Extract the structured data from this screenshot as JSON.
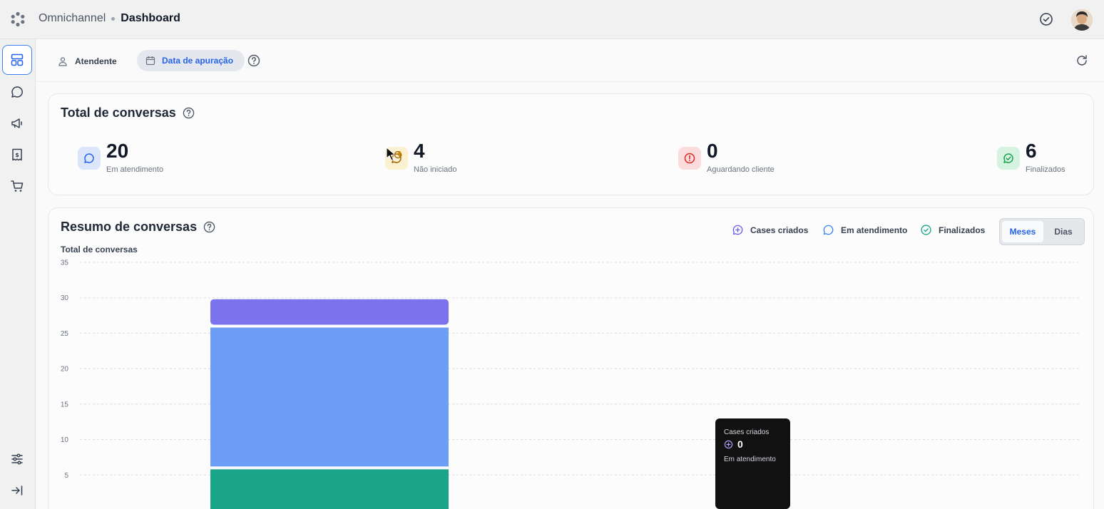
{
  "header": {
    "app_name": "Omnichannel",
    "page_title": "Dashboard"
  },
  "filters": {
    "atendente_label": "Atendente",
    "data_label": "Data de apuração"
  },
  "total_card": {
    "title": "Total de conversas",
    "stats": [
      {
        "value": "20",
        "label": "Em atendimento",
        "color": "#2563eb",
        "bg": "#dbe6fb"
      },
      {
        "value": "4",
        "label": "Não iniciado",
        "color": "#ca8a04",
        "bg": "#fbf0cf"
      },
      {
        "value": "0",
        "label": "Aguardando cliente",
        "color": "#dc2626",
        "bg": "#fbdcdc"
      },
      {
        "value": "6",
        "label": "Finalizados",
        "color": "#16a34a",
        "bg": "#d6f3e2"
      }
    ]
  },
  "resumo_card": {
    "title": "Resumo de conversas",
    "legend": [
      {
        "label": "Cases criados",
        "color": "#6d5cf0"
      },
      {
        "label": "Em atendimento",
        "color": "#3b82f6"
      },
      {
        "label": "Finalizados",
        "color": "#16a38a"
      }
    ],
    "toggle": {
      "meses": "Meses",
      "dias": "Dias"
    },
    "chart_subtitle": "Total de conversas"
  },
  "chart_data": {
    "type": "bar",
    "stacked": true,
    "y_ticks": [
      5,
      10,
      15,
      20,
      25,
      30,
      35
    ],
    "ylim": [
      0,
      35
    ],
    "bars": [
      {
        "segments": [
          {
            "series": "Finalizados",
            "value": 6,
            "color": "#1aa589"
          },
          {
            "series": "Em atendimento",
            "value": 20,
            "color": "#6d9ef5"
          },
          {
            "series": "Cases criados",
            "value": 4,
            "color": "#7b72ee"
          }
        ]
      }
    ]
  },
  "tooltip": {
    "line1_label": "Cases criados",
    "line1_value": "0",
    "line2_label": "Em atendimento"
  },
  "icons": {
    "logo": "logo-icon",
    "check": "check-circle-icon",
    "refresh": "refresh-icon",
    "sidebar": [
      "dashboard-icon",
      "chat-icon",
      "megaphone-icon",
      "receipt-icon",
      "cart-icon",
      "settings-sliders-icon",
      "collapse-icon"
    ]
  }
}
